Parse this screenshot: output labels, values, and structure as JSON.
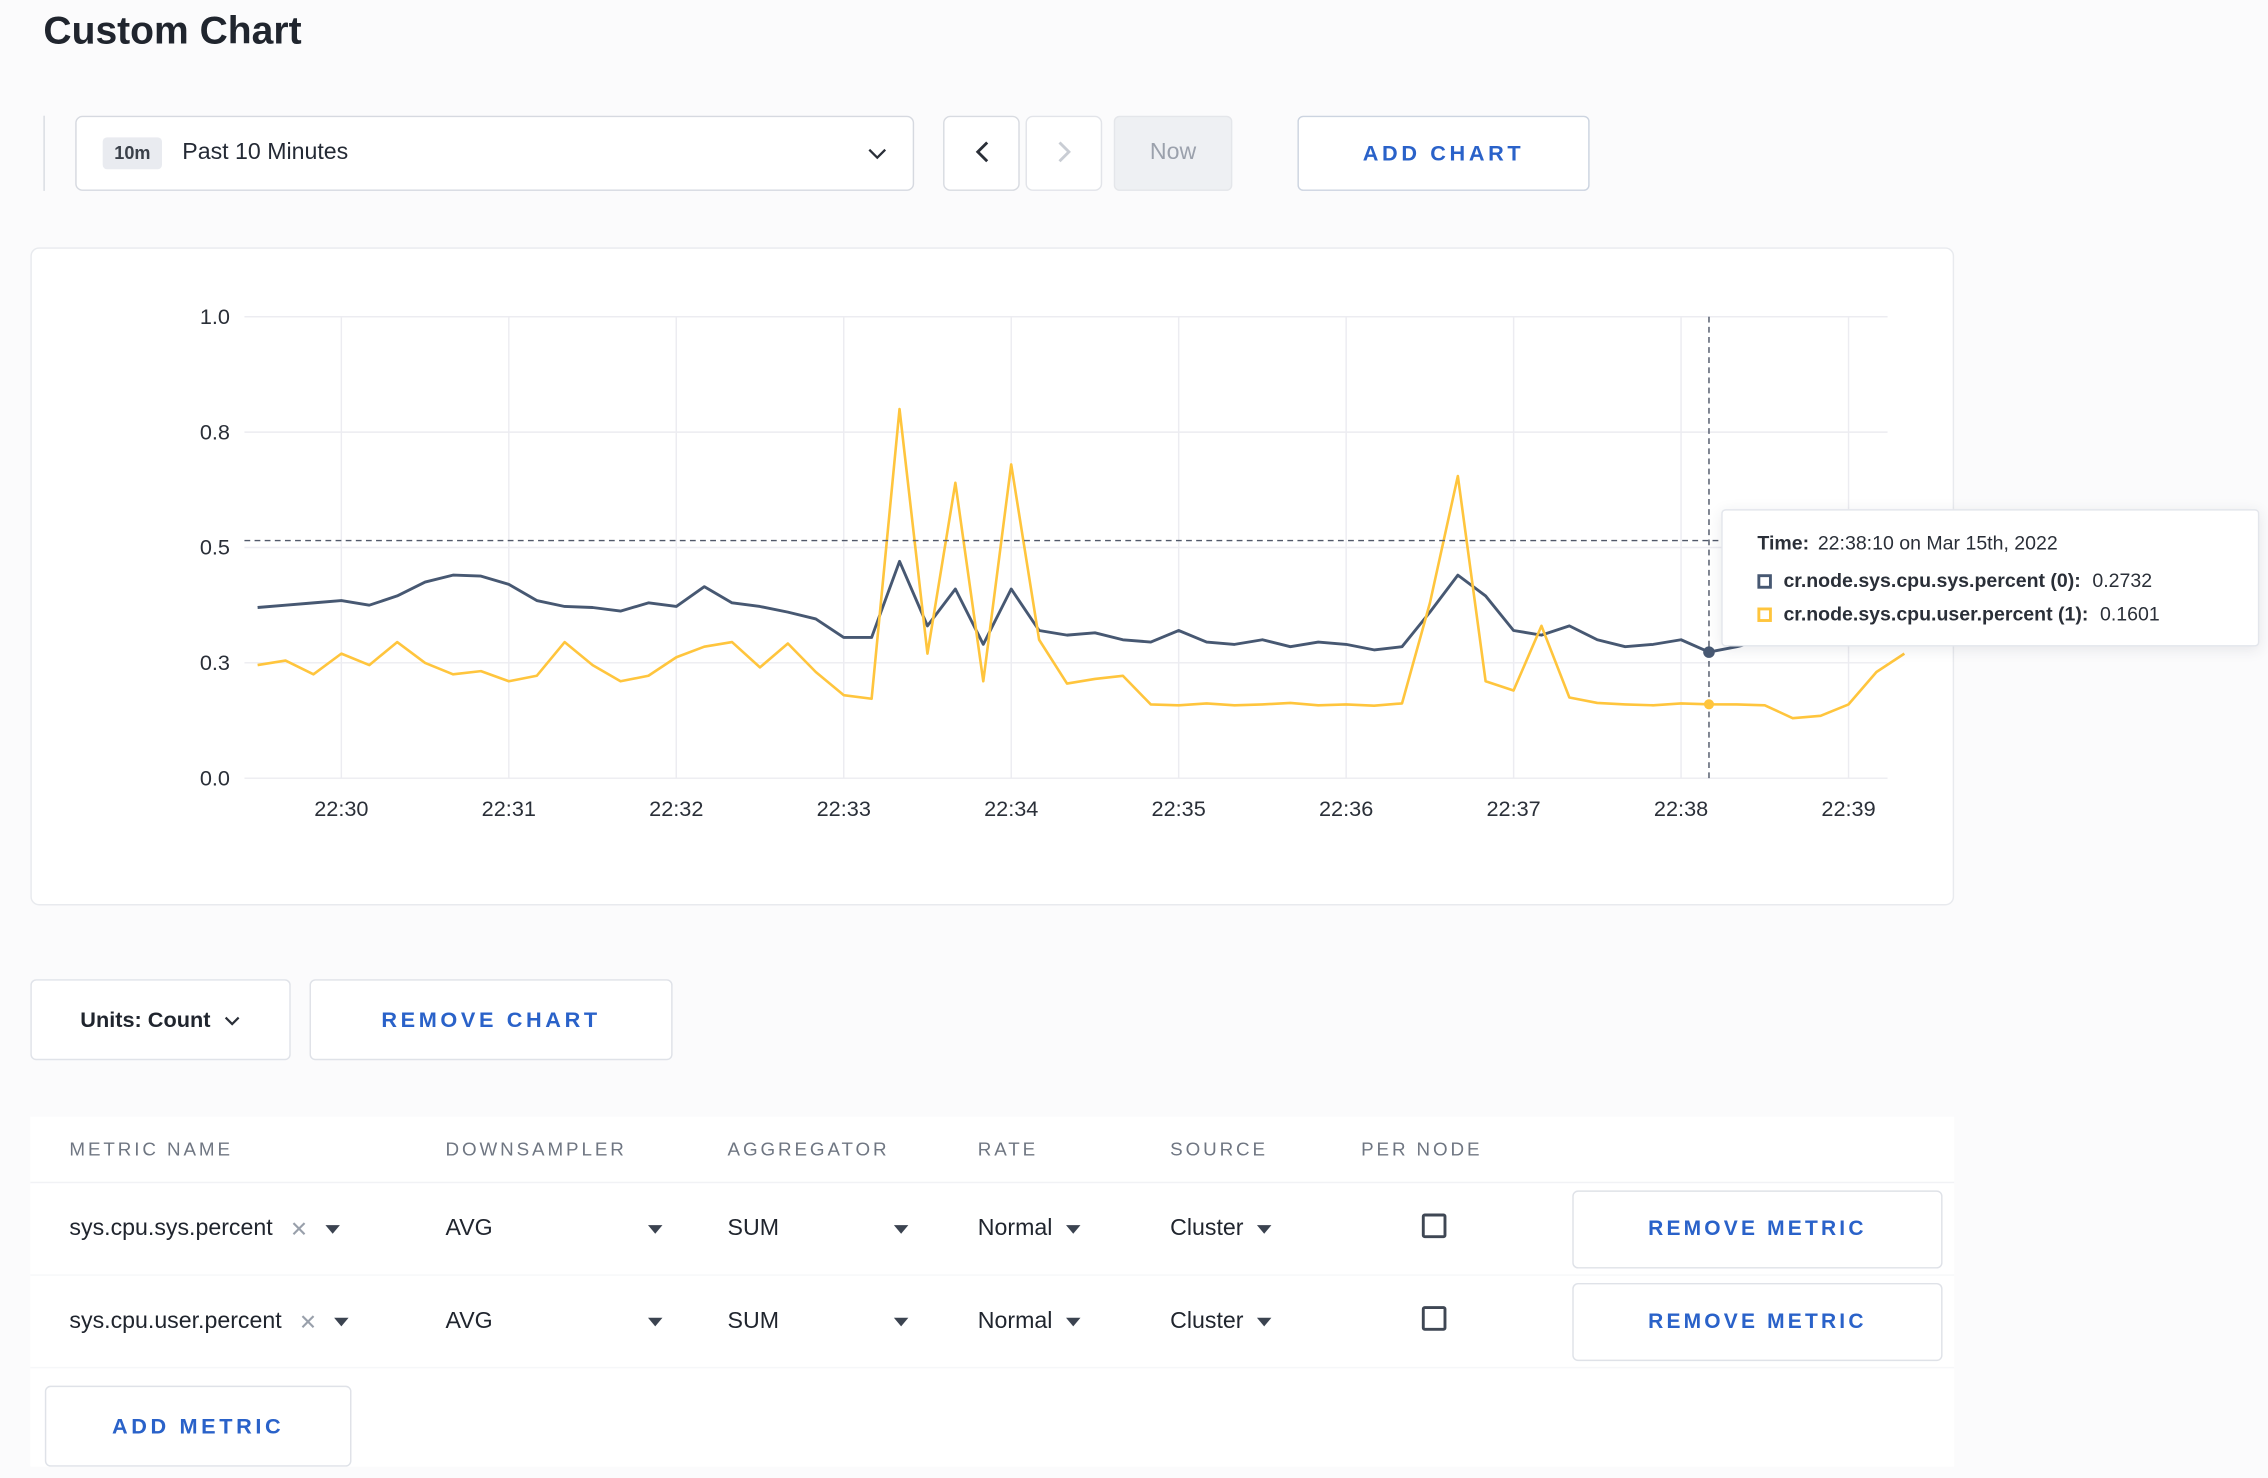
{
  "page": {
    "title": "Custom Chart"
  },
  "colors": {
    "accent_blue": "#2a62c9",
    "series_sys": "#475872",
    "series_user": "#ffc53d",
    "gridline": "#ececf1"
  },
  "toolbar": {
    "range_badge": "10m",
    "range_label": "Past 10 Minutes",
    "now_label": "Now",
    "add_chart_label": "ADD CHART"
  },
  "tooltip": {
    "time_label": "Time:",
    "time_value": "22:38:10 on Mar 15th, 2022",
    "rows": [
      {
        "label": "cr.node.sys.cpu.sys.percent (0):",
        "value": "0.2732",
        "color": "#475872"
      },
      {
        "label": "cr.node.sys.cpu.user.percent (1):",
        "value": "0.1601",
        "color": "#ffc53d"
      }
    ]
  },
  "controls": {
    "units_label": "Units: Count",
    "remove_chart_label": "REMOVE CHART",
    "add_metric_label": "ADD METRIC"
  },
  "metrics_table": {
    "headers": [
      "METRIC NAME",
      "DOWNSAMPLER",
      "AGGREGATOR",
      "RATE",
      "SOURCE",
      "PER NODE"
    ],
    "rows": [
      {
        "metric": "sys.cpu.sys.percent",
        "downsampler": "AVG",
        "aggregator": "SUM",
        "rate": "Normal",
        "source": "Cluster",
        "per_node": false,
        "remove_label": "REMOVE METRIC"
      },
      {
        "metric": "sys.cpu.user.percent",
        "downsampler": "AVG",
        "aggregator": "SUM",
        "rate": "Normal",
        "source": "Cluster",
        "per_node": false,
        "remove_label": "REMOVE METRIC"
      }
    ]
  },
  "chart_data": {
    "type": "line",
    "title": "",
    "xlabel": "",
    "ylabel": "",
    "ylim": [
      0,
      1
    ],
    "grid": true,
    "legend_position": "tooltip",
    "y_tick_values": [
      0,
      0.25,
      0.5,
      0.75,
      1.0
    ],
    "y_tick_labels": [
      "0.0",
      "0.3",
      "0.5",
      "0.8",
      "1.0"
    ],
    "x_tick_seconds": [
      0,
      60,
      120,
      180,
      240,
      300,
      360,
      420,
      480,
      540
    ],
    "x_tick_labels": [
      "22:30",
      "22:31",
      "22:32",
      "22:33",
      "22:34",
      "22:35",
      "22:36",
      "22:37",
      "22:38",
      "22:39"
    ],
    "crosshair": {
      "time_seconds": 490,
      "time_label": "22:38:10 on Mar 15th, 2022",
      "hline_value": 0.515,
      "marked_points": [
        {
          "series": 0,
          "value": 0.2732
        },
        {
          "series": 1,
          "value": 0.1601
        }
      ]
    },
    "series": [
      {
        "name": "cr.node.sys.cpu.sys.percent",
        "color": "#475872",
        "points": [
          [
            -30,
            0.37
          ],
          [
            -20,
            0.375
          ],
          [
            -10,
            0.38
          ],
          [
            0,
            0.385
          ],
          [
            10,
            0.375
          ],
          [
            20,
            0.395
          ],
          [
            30,
            0.425
          ],
          [
            40,
            0.44
          ],
          [
            50,
            0.438
          ],
          [
            60,
            0.42
          ],
          [
            70,
            0.385
          ],
          [
            80,
            0.372
          ],
          [
            90,
            0.37
          ],
          [
            100,
            0.362
          ],
          [
            110,
            0.38
          ],
          [
            120,
            0.372
          ],
          [
            130,
            0.415
          ],
          [
            140,
            0.38
          ],
          [
            150,
            0.372
          ],
          [
            160,
            0.36
          ],
          [
            170,
            0.345
          ],
          [
            180,
            0.305
          ],
          [
            190,
            0.305
          ],
          [
            200,
            0.47
          ],
          [
            210,
            0.33
          ],
          [
            220,
            0.41
          ],
          [
            230,
            0.29
          ],
          [
            240,
            0.41
          ],
          [
            250,
            0.32
          ],
          [
            260,
            0.31
          ],
          [
            270,
            0.315
          ],
          [
            280,
            0.3
          ],
          [
            290,
            0.295
          ],
          [
            300,
            0.32
          ],
          [
            310,
            0.295
          ],
          [
            320,
            0.29
          ],
          [
            330,
            0.3
          ],
          [
            340,
            0.285
          ],
          [
            350,
            0.295
          ],
          [
            360,
            0.29
          ],
          [
            370,
            0.278
          ],
          [
            380,
            0.285
          ],
          [
            390,
            0.36
          ],
          [
            400,
            0.44
          ],
          [
            410,
            0.395
          ],
          [
            420,
            0.32
          ],
          [
            430,
            0.31
          ],
          [
            440,
            0.33
          ],
          [
            450,
            0.3
          ],
          [
            460,
            0.285
          ],
          [
            470,
            0.29
          ],
          [
            480,
            0.3
          ],
          [
            490,
            0.2732
          ],
          [
            500,
            0.285
          ],
          [
            510,
            0.3
          ],
          [
            520,
            0.33
          ],
          [
            530,
            0.31
          ],
          [
            540,
            0.3
          ],
          [
            550,
            0.302
          ],
          [
            560,
            0.3
          ]
        ]
      },
      {
        "name": "cr.node.sys.cpu.user.percent",
        "color": "#ffc53d",
        "points": [
          [
            -30,
            0.245
          ],
          [
            -20,
            0.255
          ],
          [
            -10,
            0.225
          ],
          [
            0,
            0.27
          ],
          [
            10,
            0.245
          ],
          [
            20,
            0.295
          ],
          [
            30,
            0.25
          ],
          [
            40,
            0.225
          ],
          [
            50,
            0.232
          ],
          [
            60,
            0.21
          ],
          [
            70,
            0.222
          ],
          [
            80,
            0.295
          ],
          [
            90,
            0.245
          ],
          [
            100,
            0.21
          ],
          [
            110,
            0.222
          ],
          [
            120,
            0.262
          ],
          [
            130,
            0.285
          ],
          [
            140,
            0.295
          ],
          [
            150,
            0.24
          ],
          [
            160,
            0.292
          ],
          [
            170,
            0.23
          ],
          [
            180,
            0.18
          ],
          [
            190,
            0.172
          ],
          [
            200,
            0.8
          ],
          [
            210,
            0.27
          ],
          [
            220,
            0.64
          ],
          [
            230,
            0.21
          ],
          [
            240,
            0.68
          ],
          [
            250,
            0.3
          ],
          [
            260,
            0.205
          ],
          [
            270,
            0.215
          ],
          [
            280,
            0.222
          ],
          [
            290,
            0.16
          ],
          [
            300,
            0.158
          ],
          [
            310,
            0.162
          ],
          [
            320,
            0.158
          ],
          [
            330,
            0.16
          ],
          [
            340,
            0.163
          ],
          [
            350,
            0.158
          ],
          [
            360,
            0.16
          ],
          [
            370,
            0.157
          ],
          [
            380,
            0.162
          ],
          [
            390,
            0.38
          ],
          [
            400,
            0.655
          ],
          [
            410,
            0.21
          ],
          [
            420,
            0.19
          ],
          [
            430,
            0.33
          ],
          [
            440,
            0.175
          ],
          [
            450,
            0.163
          ],
          [
            460,
            0.16
          ],
          [
            470,
            0.158
          ],
          [
            480,
            0.162
          ],
          [
            490,
            0.1601
          ],
          [
            500,
            0.16
          ],
          [
            510,
            0.158
          ],
          [
            520,
            0.13
          ],
          [
            530,
            0.135
          ],
          [
            540,
            0.16
          ],
          [
            550,
            0.23
          ],
          [
            560,
            0.27
          ]
        ]
      }
    ]
  }
}
